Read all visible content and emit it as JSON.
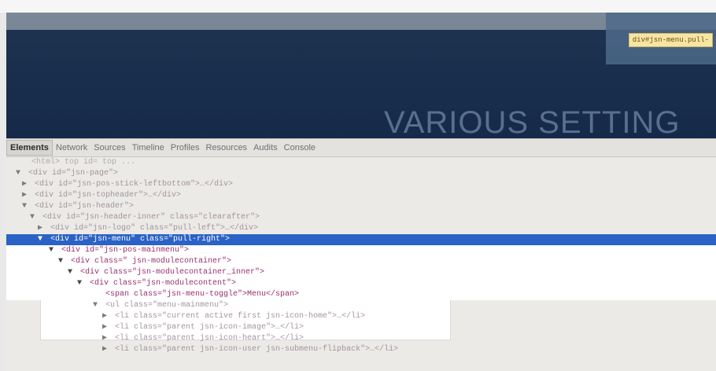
{
  "tooltip": "div#jsn-menu.pull-",
  "hero_title": "VARIOUS SETTING",
  "devtools": {
    "tabs": [
      "Elements",
      "Network",
      "Sources",
      "Timeline",
      "Profiles",
      "Resources",
      "Audits",
      "Console"
    ],
    "active_tab": "Elements",
    "lines": [
      "<html>  top  id=  top  ...",
      "<div id=\"jsn-page\">",
      "<div id=\"jsn-pos-stick-leftbottom\">…</div>",
      "<div id=\"jsn-topheader\">…</div>",
      "<div id=\"jsn-header\">",
      "<div id=\"jsn-header-inner\" class=\"clearafter\">",
      "<div id=\"jsn-logo\" class=\"pull-left\">…</div>",
      "<div id=\"jsn-menu\" class=\"pull-right\">",
      "<div id=\"jsn-pos-mainmenu\">",
      "<div class=\" jsn-modulecontainer\">",
      "<div class=\"jsn-modulecontainer_inner\">",
      "<div class=\"jsn-modulecontent\">",
      "<span class=\"jsn-menu-toggle\">Menu</span>",
      "<ul class=\"menu-mainmenu\">",
      "<li class=\"current active first jsn-icon-home\">…</li>",
      "<li class=\"parent jsn-icon-image\">…</li>",
      "<li class=\"parent jsn-icon-heart\">…</li>",
      "<li class=\"parent jsn-icon-user jsn-submenu-flipback\">…</li>"
    ]
  }
}
